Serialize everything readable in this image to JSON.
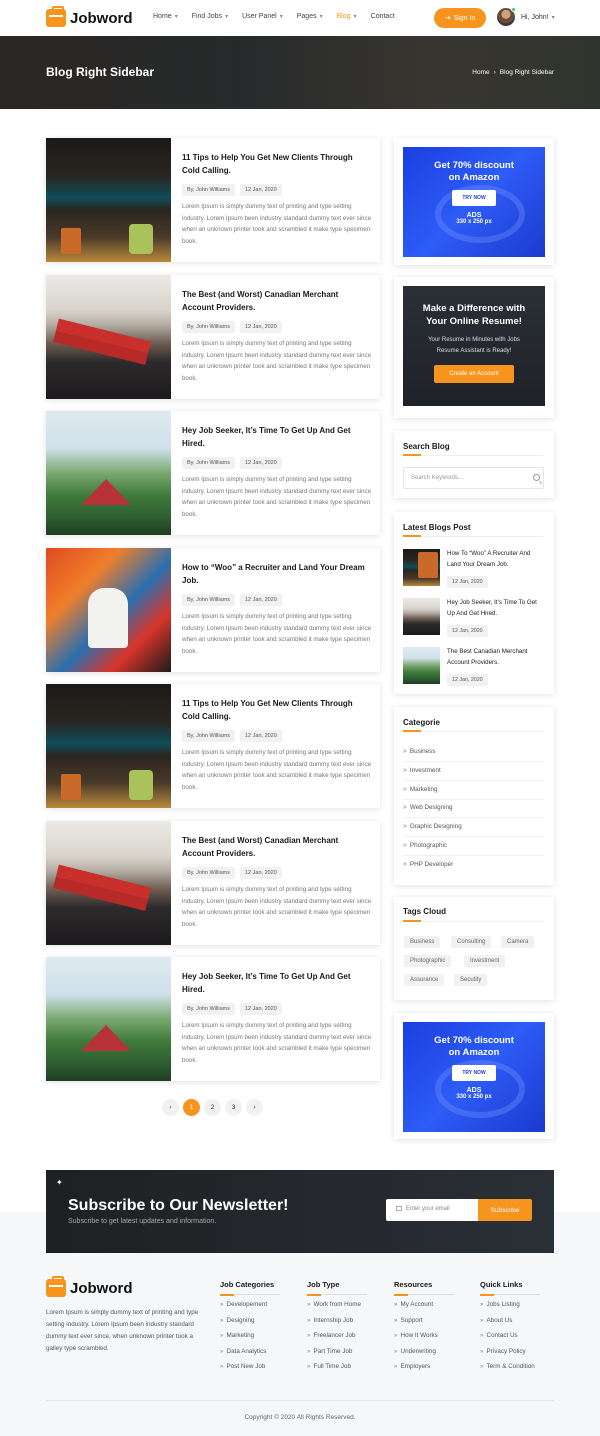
{
  "header": {
    "logo": "Jobword",
    "nav": [
      {
        "label": "Home",
        "caret": true
      },
      {
        "label": "Find Jobs",
        "caret": true
      },
      {
        "label": "User Panel",
        "caret": true
      },
      {
        "label": "Pages",
        "caret": true
      },
      {
        "label": "Blog",
        "caret": true,
        "active": true
      },
      {
        "label": "Contact",
        "caret": false
      }
    ],
    "signin": "Sign In",
    "user": "Hi, John!"
  },
  "banner": {
    "title": "Blog Right Sidebar",
    "crumb_home": "Home",
    "crumb_sep": "›",
    "crumb_current": "Blog Right Sidebar"
  },
  "posts": [
    {
      "title": "11 Tips to Help You Get New Clients Through Cold Calling.",
      "author": "By, John Williams",
      "date": "12 Jan, 2020",
      "excerpt": "Lorem Ipsum is simply dummy text of printing and type setting industry. Lorem Ipsum been industry standard dummy text ever since when an unknown printer took and scrambled it make type specimen book.",
      "image": "bar"
    },
    {
      "title": "The Best (and Worst) Canadian Merchant Account Providers.",
      "author": "By, John Williams",
      "date": "12 Jan, 2020",
      "excerpt": "Lorem Ipsum is simply dummy text of printing and type setting industry. Lorem Ipsum been industry standard dummy text ever since when an unknown printer took and scrambled it make type specimen book.",
      "image": "beach"
    },
    {
      "title": "Hey Job Seeker, It’s Time To Get Up And Get Hired.",
      "author": "By, John Williams",
      "date": "12 Jan, 2020",
      "excerpt": "Lorem Ipsum is simply dummy text of printing and type setting industry. Lorem Ipsum been industry standard dummy text ever since when an unknown printer took and scrambled it make type specimen book.",
      "image": "palm"
    },
    {
      "title": "How to “Woo” a Recruiter and Land Your Dream Job.",
      "author": "By, John Williams",
      "date": "12 Jan, 2020",
      "excerpt": "Lorem Ipsum is simply dummy text of printing and type setting industry. Lorem Ipsum been industry standard dummy text ever since when an unknown printer took and scrambled it make type specimen book.",
      "image": "art"
    },
    {
      "title": "11 Tips to Help You Get New Clients Through Cold Calling.",
      "author": "By, John Williams",
      "date": "12 Jan, 2020",
      "excerpt": "Lorem Ipsum is simply dummy text of printing and type setting industry. Lorem Ipsum been industry standard dummy text ever since when an unknown printer took and scrambled it make type specimen book.",
      "image": "bar"
    },
    {
      "title": "The Best (and Worst) Canadian Merchant Account Providers.",
      "author": "By, John Williams",
      "date": "12 Jan, 2020",
      "excerpt": "Lorem Ipsum is simply dummy text of printing and type setting industry. Lorem Ipsum been industry standard dummy text ever since when an unknown printer took and scrambled it make type specimen book.",
      "image": "beach"
    },
    {
      "title": "Hey Job Seeker, It’s Time To Get Up And Get Hired.",
      "author": "By, John Williams",
      "date": "12 Jan, 2020",
      "excerpt": "Lorem Ipsum is simply dummy text of printing and type setting industry. Lorem Ipsum been industry standard dummy text ever since when an unknown printer took and scrambled it make type specimen book.",
      "image": "palm"
    }
  ],
  "pagination": {
    "prev": "‹",
    "pages": [
      "1",
      "2",
      "3"
    ],
    "active_page": "1",
    "next": "›"
  },
  "sidebar": {
    "ad": {
      "title_line1": "Get 70% discount",
      "title_line2": "on Amazon",
      "button": "TRY NOW",
      "label": "ADS",
      "size": "330 x 250 px"
    },
    "cta": {
      "title_line1": "Make a Difference with",
      "title_line2": "Your Online Resume!",
      "text_line1": "Your Resume in Minutes with Jobs",
      "text_line2": "Resume Assistant is Ready!",
      "button": "Create an Account"
    },
    "search": {
      "title": "Search Blog",
      "placeholder": "Search Keywords..."
    },
    "latest": {
      "title": "Latest Blogs Post",
      "items": [
        {
          "title": "How To “Woo” A Recruiter And Land Your Dream Job.",
          "date": "12 Jan, 2020",
          "image": "bar"
        },
        {
          "title": "Hey Job Seeker, It’s Time To Get Up And Get Hired.",
          "date": "12 Jan, 2020",
          "image": "beach"
        },
        {
          "title": "The Best Canadian Merchant Account Providers.",
          "date": "12 Jan, 2020",
          "image": "palm"
        }
      ]
    },
    "categories": {
      "title": "Categorie",
      "items": [
        "Business",
        "Investment",
        "Marketing",
        "Web Designing",
        "Graphic Designing",
        "Photographic",
        "PHP Developer"
      ]
    },
    "tags": {
      "title": "Tags Cloud",
      "items": [
        "Business",
        "Consulting",
        "Camera",
        "Photographic",
        "Investment",
        "Assurance",
        "Secutity"
      ]
    }
  },
  "newsletter": {
    "title": "Subscribe to Our Newsletter!",
    "subtitle": "Subscribe to get latest updates and information.",
    "placeholder": "Enter your email",
    "button": "Subscribe"
  },
  "footer": {
    "logo": "Jobword",
    "about": "Lorem Ipsum is simply dummy text of printing and type setting industry. Lorem Ipsum been industry standard dummy text ever since, when unknown printer took a galley type scrambled.",
    "columns": [
      {
        "title": "Job Categories",
        "links": [
          "Developement",
          "Designing",
          "Marketing",
          "Data Analytics",
          "Post New Job"
        ]
      },
      {
        "title": "Job Type",
        "links": [
          "Work from Home",
          "Internship Job",
          "Freelancer Job",
          "Part Time Job",
          "Full Time Job"
        ]
      },
      {
        "title": "Resources",
        "links": [
          "My Account",
          "Support",
          "How It Works",
          "Underwriting",
          "Employers"
        ]
      },
      {
        "title": "Quick Links",
        "links": [
          "Jobs Listing",
          "About Us",
          "Contact Us",
          "Privacy Policy",
          "Term & Condition"
        ]
      }
    ],
    "copyright": "Copyright © 2020 All Rights Reserved."
  },
  "colors": {
    "accent": "#f7941d",
    "ad_blue": "#1b3fe0",
    "dark": "#1f2328"
  }
}
